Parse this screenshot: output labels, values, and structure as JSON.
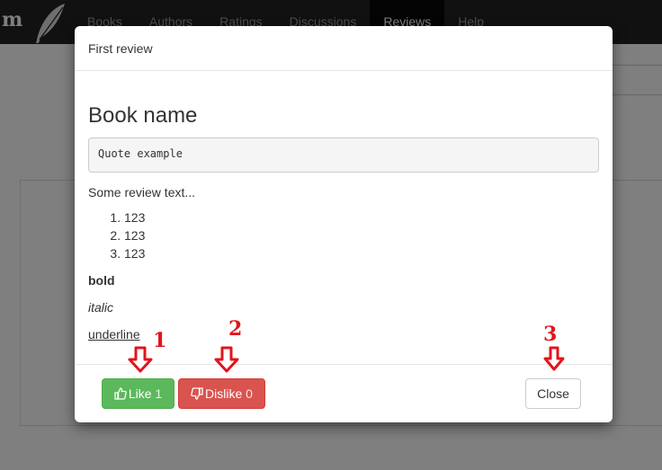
{
  "navbar": {
    "brand": "m",
    "links": [
      "Books",
      "Authors",
      "Ratings",
      "Discussions",
      "Reviews",
      "Help"
    ],
    "active": "Reviews"
  },
  "modal": {
    "title": "First review",
    "book_name": "Book name",
    "quote": "Quote example",
    "review_text": "Some review text...",
    "list_items": [
      "123",
      "123",
      "123"
    ],
    "bold_text": "bold",
    "italic_text": "italic",
    "underline_text": "underline"
  },
  "footer": {
    "like_label": "Like",
    "like_count": "1",
    "dislike_label": "Dislike",
    "dislike_count": "0",
    "close_label": "Close"
  },
  "annotations": [
    "1",
    "2",
    "3"
  ],
  "colors": {
    "like": "#5cb85c",
    "dislike": "#d9534f",
    "annotation": "#e3141c",
    "navbar": "#222222"
  }
}
